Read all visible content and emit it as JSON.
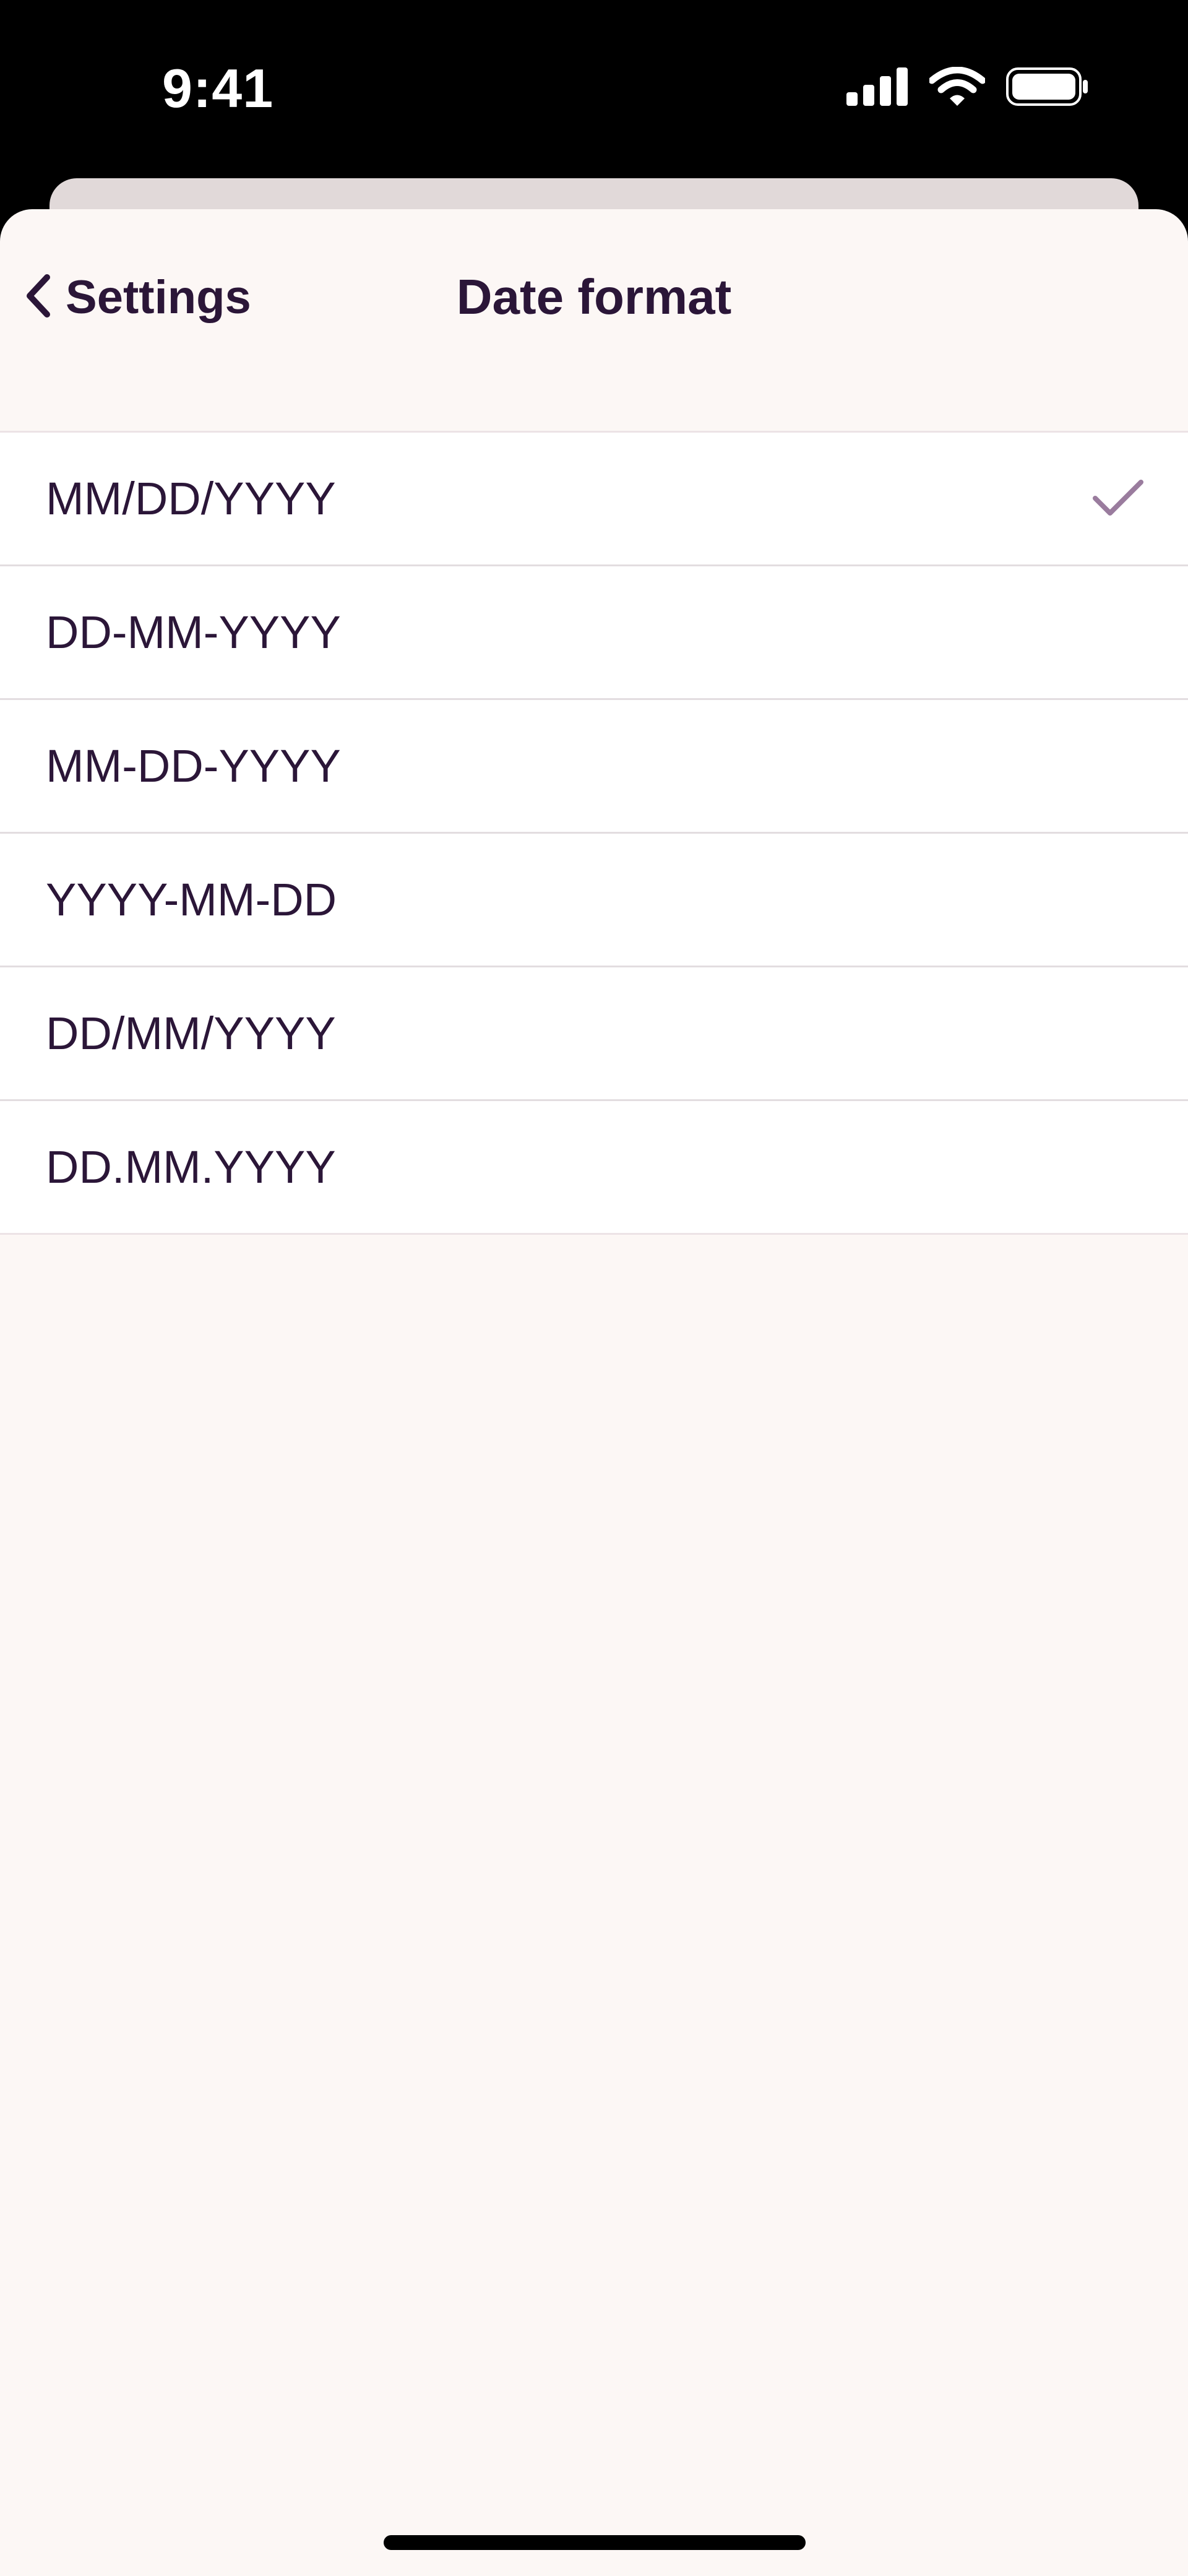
{
  "status_bar": {
    "time": "9:41",
    "icons": [
      "cellular-signal-icon",
      "wifi-icon",
      "battery-icon"
    ]
  },
  "nav": {
    "back_label": "Settings",
    "back_icon": "chevron-left-icon",
    "title": "Date format"
  },
  "options": [
    {
      "label": "MM/DD/YYYY",
      "selected": true
    },
    {
      "label": "DD-MM-YYYY",
      "selected": false
    },
    {
      "label": "MM-DD-YYYY",
      "selected": false
    },
    {
      "label": "YYYY-MM-DD",
      "selected": false
    },
    {
      "label": "DD/MM/YYYY",
      "selected": false
    },
    {
      "label": "DD.MM.YYYY",
      "selected": false
    }
  ],
  "colors": {
    "text": "#2b1638",
    "sheet_background": "#fcf7f5",
    "checkmark": "#9a7c9e",
    "status_bar": "#000000"
  }
}
